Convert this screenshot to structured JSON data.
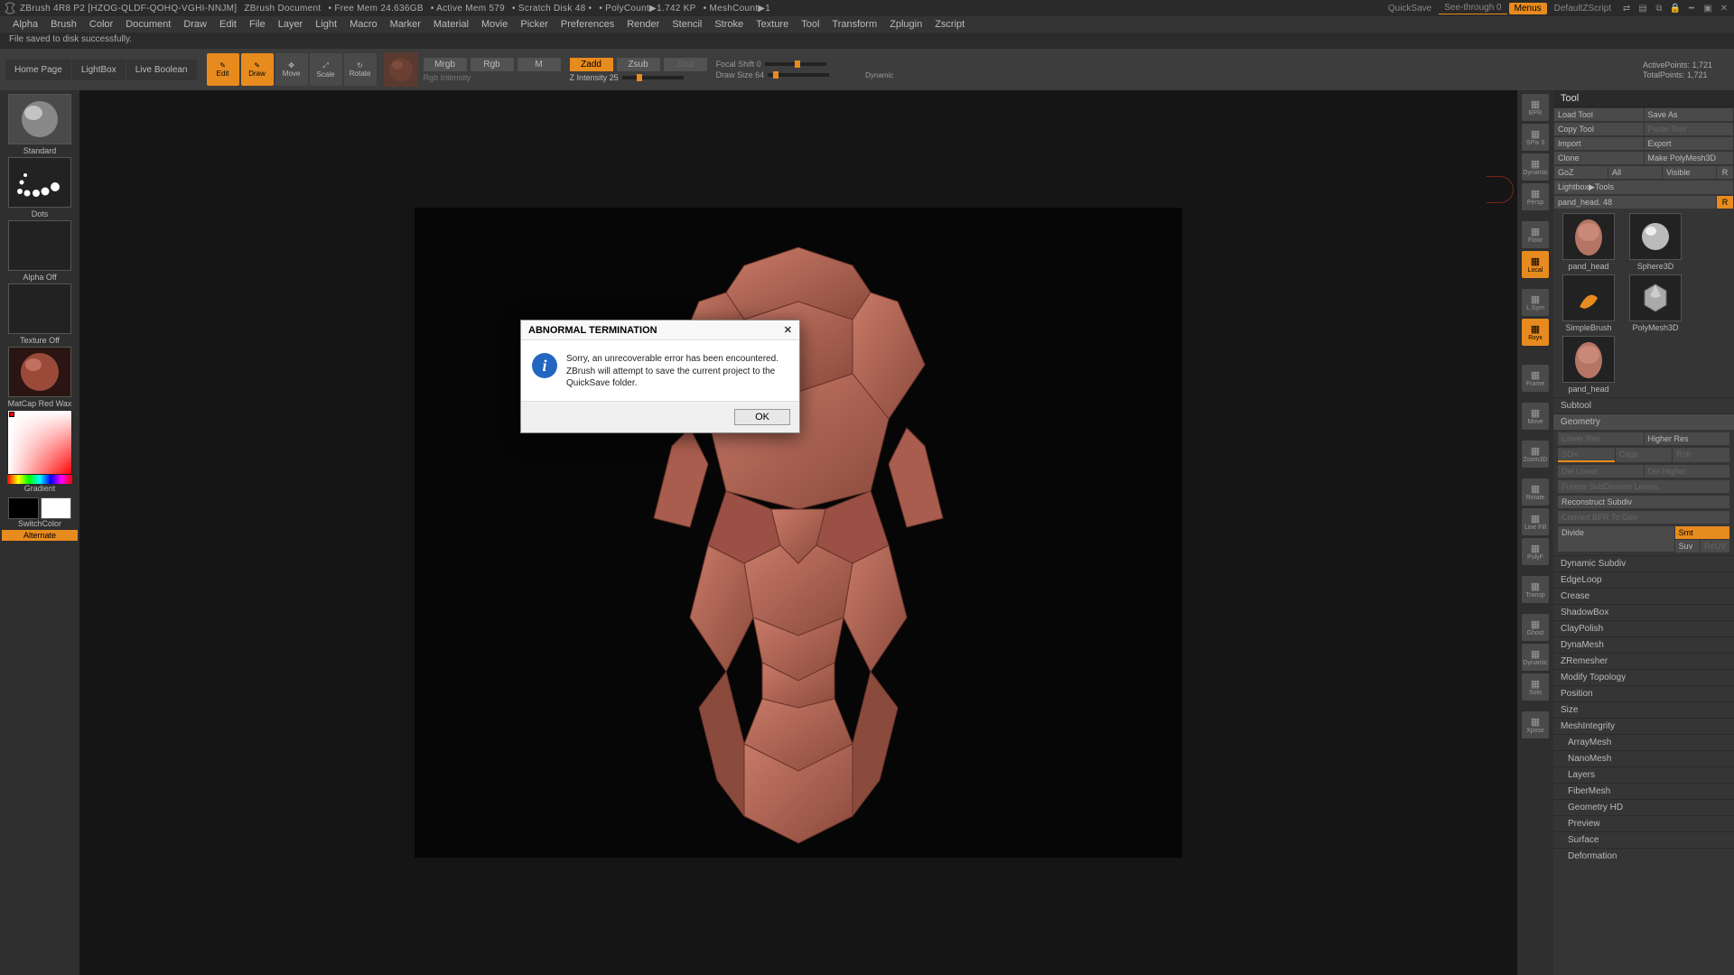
{
  "titlebar": {
    "app": "ZBrush 4R8 P2 [HZOG-QLDF-QOHQ-VGHI-NNJM]",
    "doc": "ZBrush Document",
    "freemem": "• Free Mem 24.636GB",
    "activemem": "• Active Mem 579",
    "scratch": "• Scratch Disk 48 •",
    "polycount": "• PolyCount▶1.742 KP",
    "meshcount": "• MeshCount▶1",
    "quicksave": "QuickSave",
    "seethrough": "See-through  0",
    "menus": "Menus",
    "zscript": "DefaultZScript"
  },
  "menubar": [
    "Alpha",
    "Brush",
    "Color",
    "Document",
    "Draw",
    "Edit",
    "File",
    "Layer",
    "Light",
    "Macro",
    "Marker",
    "Material",
    "Movie",
    "Picker",
    "Preferences",
    "Render",
    "Stencil",
    "Stroke",
    "Texture",
    "Tool",
    "Transform",
    "Zplugin",
    "Zscript"
  ],
  "status": "File saved to disk successfully.",
  "shelf": {
    "tabs": [
      "Home Page",
      "LightBox",
      "Live Boolean"
    ],
    "tools": [
      "Edit",
      "Draw",
      "Move",
      "Scale",
      "Rotate"
    ],
    "blend": {
      "mrgb": "Mrgb",
      "rgb": "Rgb",
      "m": "M",
      "zadd": "Zadd",
      "zsub": "Zsub",
      "zcut": "Zcut"
    },
    "rgbint": "Rgb Intensity",
    "zint": "Z Intensity 25",
    "focal": "Focal Shift 0",
    "drawsize": "Draw Size 64",
    "dynamic": "Dynamic",
    "activepts": "ActivePoints: 1,721",
    "totalpts": "TotalPoints: 1,721"
  },
  "left": {
    "brush": "Standard",
    "stroke": "Dots",
    "alpha": "Alpha Off",
    "texture": "Texture Off",
    "material": "MatCap Red Wax",
    "gradient": "Gradient",
    "switch": "SwitchColor",
    "alternate": "Alternate"
  },
  "rstrip": [
    "BPR",
    "SPix 3",
    "Dynamic",
    "Persp",
    "",
    "Floor",
    "Local",
    "",
    "L.Sym",
    "Rxyx",
    "",
    "",
    "Frame",
    "",
    "Move",
    "",
    "Zoom3D",
    "",
    "Rotate",
    "Line Fill",
    "PolyF",
    "",
    "Transp",
    "",
    "Ghost",
    "Dynamic",
    "Solo",
    "",
    "Xpose"
  ],
  "tool": {
    "title": "Tool",
    "row1": [
      "Load Tool",
      "Save As"
    ],
    "row2": [
      "Copy Tool",
      "Paste Tool"
    ],
    "row3": [
      "Import",
      "Export"
    ],
    "row4": [
      "Clone",
      "Make PolyMesh3D"
    ],
    "row5": [
      "GoZ",
      "All",
      "Visible",
      "R"
    ],
    "row6": "Lightbox▶Tools",
    "row7": [
      "pand_head. 48",
      "R"
    ],
    "items": [
      "pand_head",
      "Sphere3D",
      "SimpleBrush",
      "PolyMesh3D",
      "pand_head"
    ],
    "sections": [
      "Subtool",
      "Geometry"
    ],
    "geo": {
      "r1": [
        "Lower Res",
        "Higher Res"
      ],
      "r2": [
        "SDiv",
        "Cage",
        "Rstr"
      ],
      "r3": [
        "Del Lower",
        "Del Higher"
      ],
      "r4": "Freeze SubDivision Levels",
      "r5": "Reconstruct Subdiv",
      "r6": "Convert BPR To Geo",
      "r7": [
        "Divide",
        "Smt"
      ],
      "r8": [
        "Suv",
        "ReUV"
      ]
    },
    "geosecs": [
      "Dynamic Subdiv",
      "EdgeLoop",
      "Crease",
      "ShadowBox",
      "ClayPolish",
      "DynaMesh",
      "ZRemesher",
      "Modify Topology",
      "Position",
      "Size",
      "MeshIntegrity"
    ],
    "others": [
      "ArrayMesh",
      "NanoMesh",
      "Layers",
      "FiberMesh",
      "Geometry HD",
      "Preview",
      "Surface",
      "Deformation"
    ]
  },
  "dialog": {
    "title": "ABNORMAL TERMINATION",
    "text": "Sorry, an unrecoverable error has been encountered. ZBrush will attempt to save the current project to the QuickSave folder.",
    "ok": "OK"
  }
}
